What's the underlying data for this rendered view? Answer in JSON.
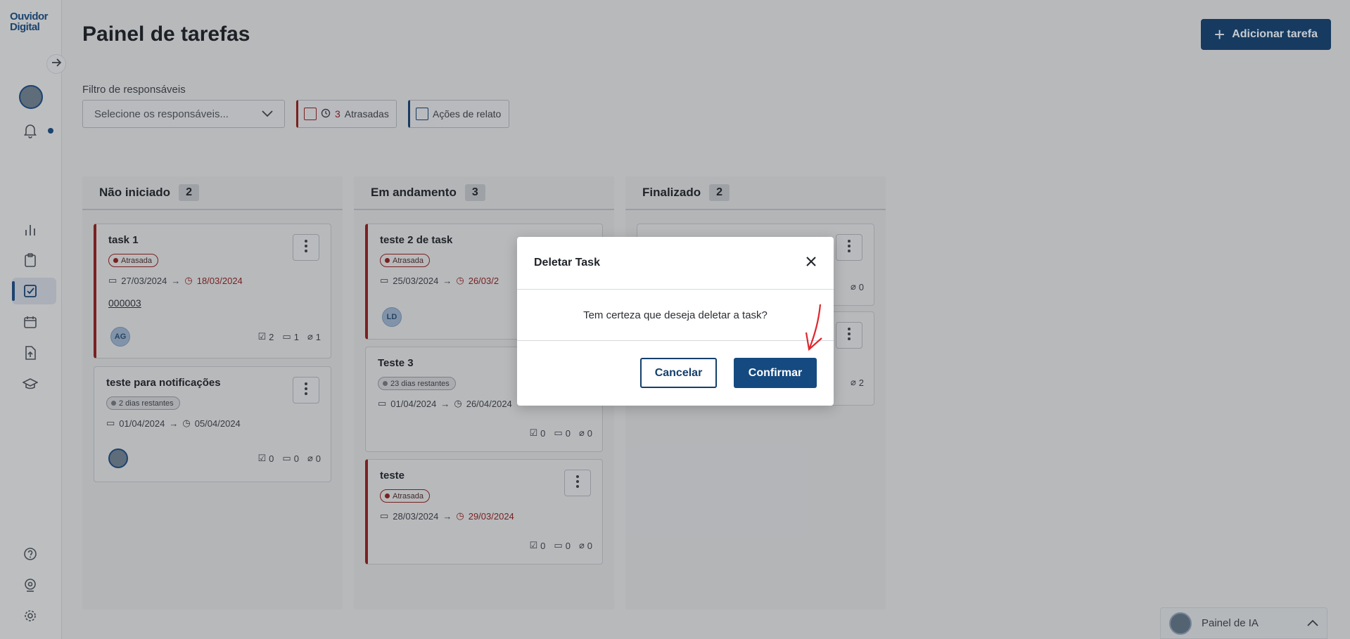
{
  "sidebar": {
    "logo_line1": "Ouvidor",
    "logo_line2": "Digital",
    "icons": [
      "arrow-right-icon",
      "avatar",
      "bell-icon",
      "chart-icon",
      "clipboard-icon",
      "task-check-icon",
      "calendar-icon",
      "file-upload-icon",
      "graduation-cap-icon",
      "help-icon",
      "webcam-icon",
      "gear-icon"
    ]
  },
  "header": {
    "title": "Painel de tarefas",
    "add_button": "Adicionar tarefa"
  },
  "filters": {
    "label": "Filtro de responsáveis",
    "select_placeholder": "Selecione os responsáveis...",
    "late_count": "3",
    "late_label": "Atrasadas",
    "report_label": "Ações de relato"
  },
  "columns": [
    {
      "title": "Não iniciado",
      "count": "2",
      "cards": [
        {
          "title": "task 1",
          "badge": "Atrasada",
          "start": "27/03/2024",
          "due": "18/03/2024",
          "link": "000003",
          "assignee": "AG",
          "checks": "2",
          "comments": "1",
          "attachments": "1"
        },
        {
          "title": "teste para notificações",
          "badge": "2 dias restantes",
          "start": "01/04/2024",
          "due": "05/04/2024",
          "checks": "0",
          "comments": "0",
          "attachments": "0"
        }
      ]
    },
    {
      "title": "Em andamento",
      "count": "3",
      "cards": [
        {
          "title": "teste 2 de task",
          "badge": "Atrasada",
          "start": "25/03/2024",
          "due": "26/03/2",
          "assignee": "LD"
        },
        {
          "title": "Teste 3",
          "badge": "23 dias restantes",
          "start": "01/04/2024",
          "due": "26/04/2024",
          "checks": "0",
          "comments": "0",
          "attachments": "0"
        },
        {
          "title": "teste",
          "badge": "Atrasada",
          "start": "28/03/2024",
          "due": "29/03/2024",
          "checks": "0",
          "comments": "0",
          "attachments": "0"
        }
      ]
    },
    {
      "title": "Finalizado",
      "count": "2",
      "cards": [
        {
          "attachments": "0"
        },
        {
          "attachments": "2"
        }
      ]
    }
  ],
  "modal": {
    "title": "Deletar Task",
    "message": "Tem certeza que deseja deletar a task?",
    "cancel": "Cancelar",
    "confirm": "Confirmar"
  },
  "ai_panel": {
    "label": "Painel de IA"
  },
  "colors": {
    "primary": "#154a80",
    "late": "#8b1e1e",
    "annotation": "#e0262b"
  }
}
